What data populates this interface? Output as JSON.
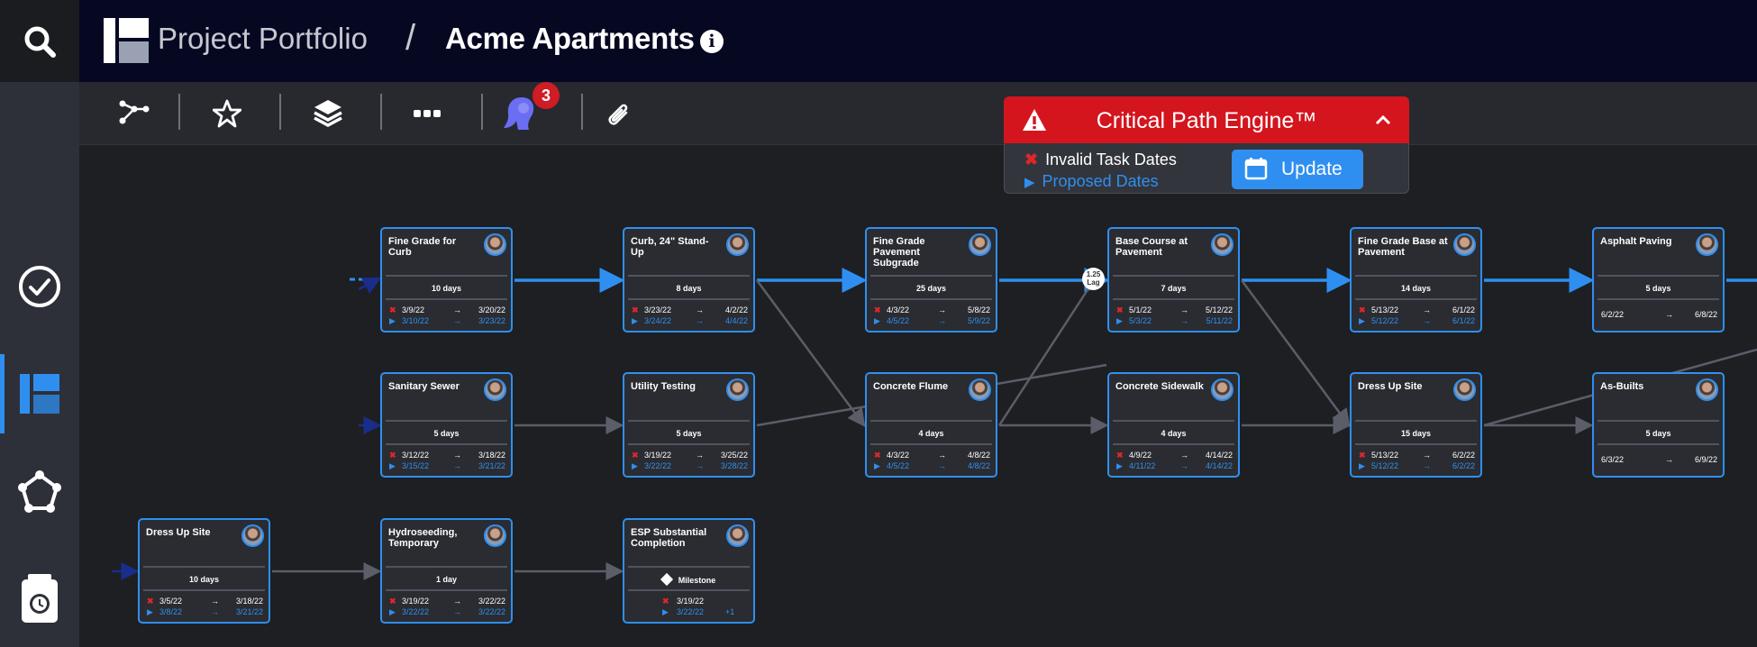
{
  "header": {
    "search_icon": "search-icon",
    "logo_icon": "portfolio-logo-icon",
    "breadcrumb": [
      "Project Portfolio",
      "Acme Apartments"
    ],
    "separator": "/",
    "info_icon": "i"
  },
  "sidebar": {
    "items": [
      {
        "icon": "check-circle-icon",
        "active": false
      },
      {
        "icon": "schedule-board-icon",
        "active": true
      },
      {
        "icon": "network-pentagon-icon",
        "active": false
      },
      {
        "icon": "clipboard-clock-icon",
        "active": false
      }
    ]
  },
  "toolbar": {
    "items": [
      "path-icon",
      "star-icon",
      "layers-icon",
      "more-icon",
      "user-profile-icon",
      "paperclip-icon"
    ],
    "notification_count": "3"
  },
  "critical_path": {
    "title": "Critical Path Engine™",
    "invalid_label": "Invalid Task Dates",
    "proposed_label": "Proposed Dates",
    "update_label": "Update",
    "colors": {
      "header": "#d4151e",
      "accent": "#2f8ff0"
    }
  },
  "lag_label": "1.25 Lag",
  "tasks": [
    {
      "name": "Fine Grade for Curb",
      "duration": "10 days",
      "start": "3/9/22",
      "end": "3/20/22",
      "p_start": "3/10/22",
      "p_end": "3/23/22"
    },
    {
      "name": "Curb, 24\" Stand-Up",
      "duration": "8 days",
      "start": "3/23/22",
      "end": "4/2/22",
      "p_start": "3/24/22",
      "p_end": "4/4/22"
    },
    {
      "name": "Fine Grade Pavement Subgrade",
      "duration": "25 days",
      "start": "4/3/22",
      "end": "5/8/22",
      "p_start": "4/5/22",
      "p_end": "5/9/22"
    },
    {
      "name": "Base Course at Pavement",
      "duration": "7 days",
      "start": "5/1/22",
      "end": "5/12/22",
      "p_start": "5/3/22",
      "p_end": "5/11/22"
    },
    {
      "name": "Fine Grade Base at Pavement",
      "duration": "14 days",
      "start": "5/13/22",
      "end": "6/1/22",
      "p_start": "5/12/22",
      "p_end": "6/1/22"
    },
    {
      "name": "Asphalt Paving",
      "duration": "5 days",
      "start": "6/2/22",
      "end": "6/8/22"
    },
    {
      "name": "Sanitary Sewer",
      "duration": "5 days",
      "start": "3/12/22",
      "end": "3/18/22",
      "p_start": "3/15/22",
      "p_end": "3/21/22"
    },
    {
      "name": "Utility Testing",
      "duration": "5 days",
      "start": "3/19/22",
      "end": "3/25/22",
      "p_start": "3/22/22",
      "p_end": "3/28/22"
    },
    {
      "name": "Concrete Flume",
      "duration": "4 days",
      "start": "4/3/22",
      "end": "4/8/22",
      "p_start": "4/5/22",
      "p_end": "4/8/22"
    },
    {
      "name": "Concrete Sidewalk",
      "duration": "4 days",
      "start": "4/9/22",
      "end": "4/14/22",
      "p_start": "4/11/22",
      "p_end": "4/14/22"
    },
    {
      "name": "Dress Up Site",
      "duration": "15 days",
      "start": "5/13/22",
      "end": "6/2/22",
      "p_start": "5/12/22",
      "p_end": "6/2/22"
    },
    {
      "name": "As-Builts",
      "duration": "5 days",
      "start": "6/3/22",
      "end": "6/9/22"
    },
    {
      "name": "Dress Up Site",
      "duration": "10 days",
      "start": "3/5/22",
      "end": "3/18/22",
      "p_start": "3/8/22",
      "p_end": "3/21/22"
    },
    {
      "name": "Hydroseeding, Temporary",
      "duration": "1 day",
      "start": "3/19/22",
      "end": "3/22/22",
      "p_start": "3/22/22",
      "p_end": "3/22/22"
    },
    {
      "name": "ESP Substantial Completion",
      "milestone_label": "Milestone",
      "start": "3/19/22",
      "p_start": "3/22/22",
      "p_extra": "+1"
    }
  ],
  "arrow_glyph": "→",
  "invalid_marker": "✖",
  "proposed_marker": "▶"
}
